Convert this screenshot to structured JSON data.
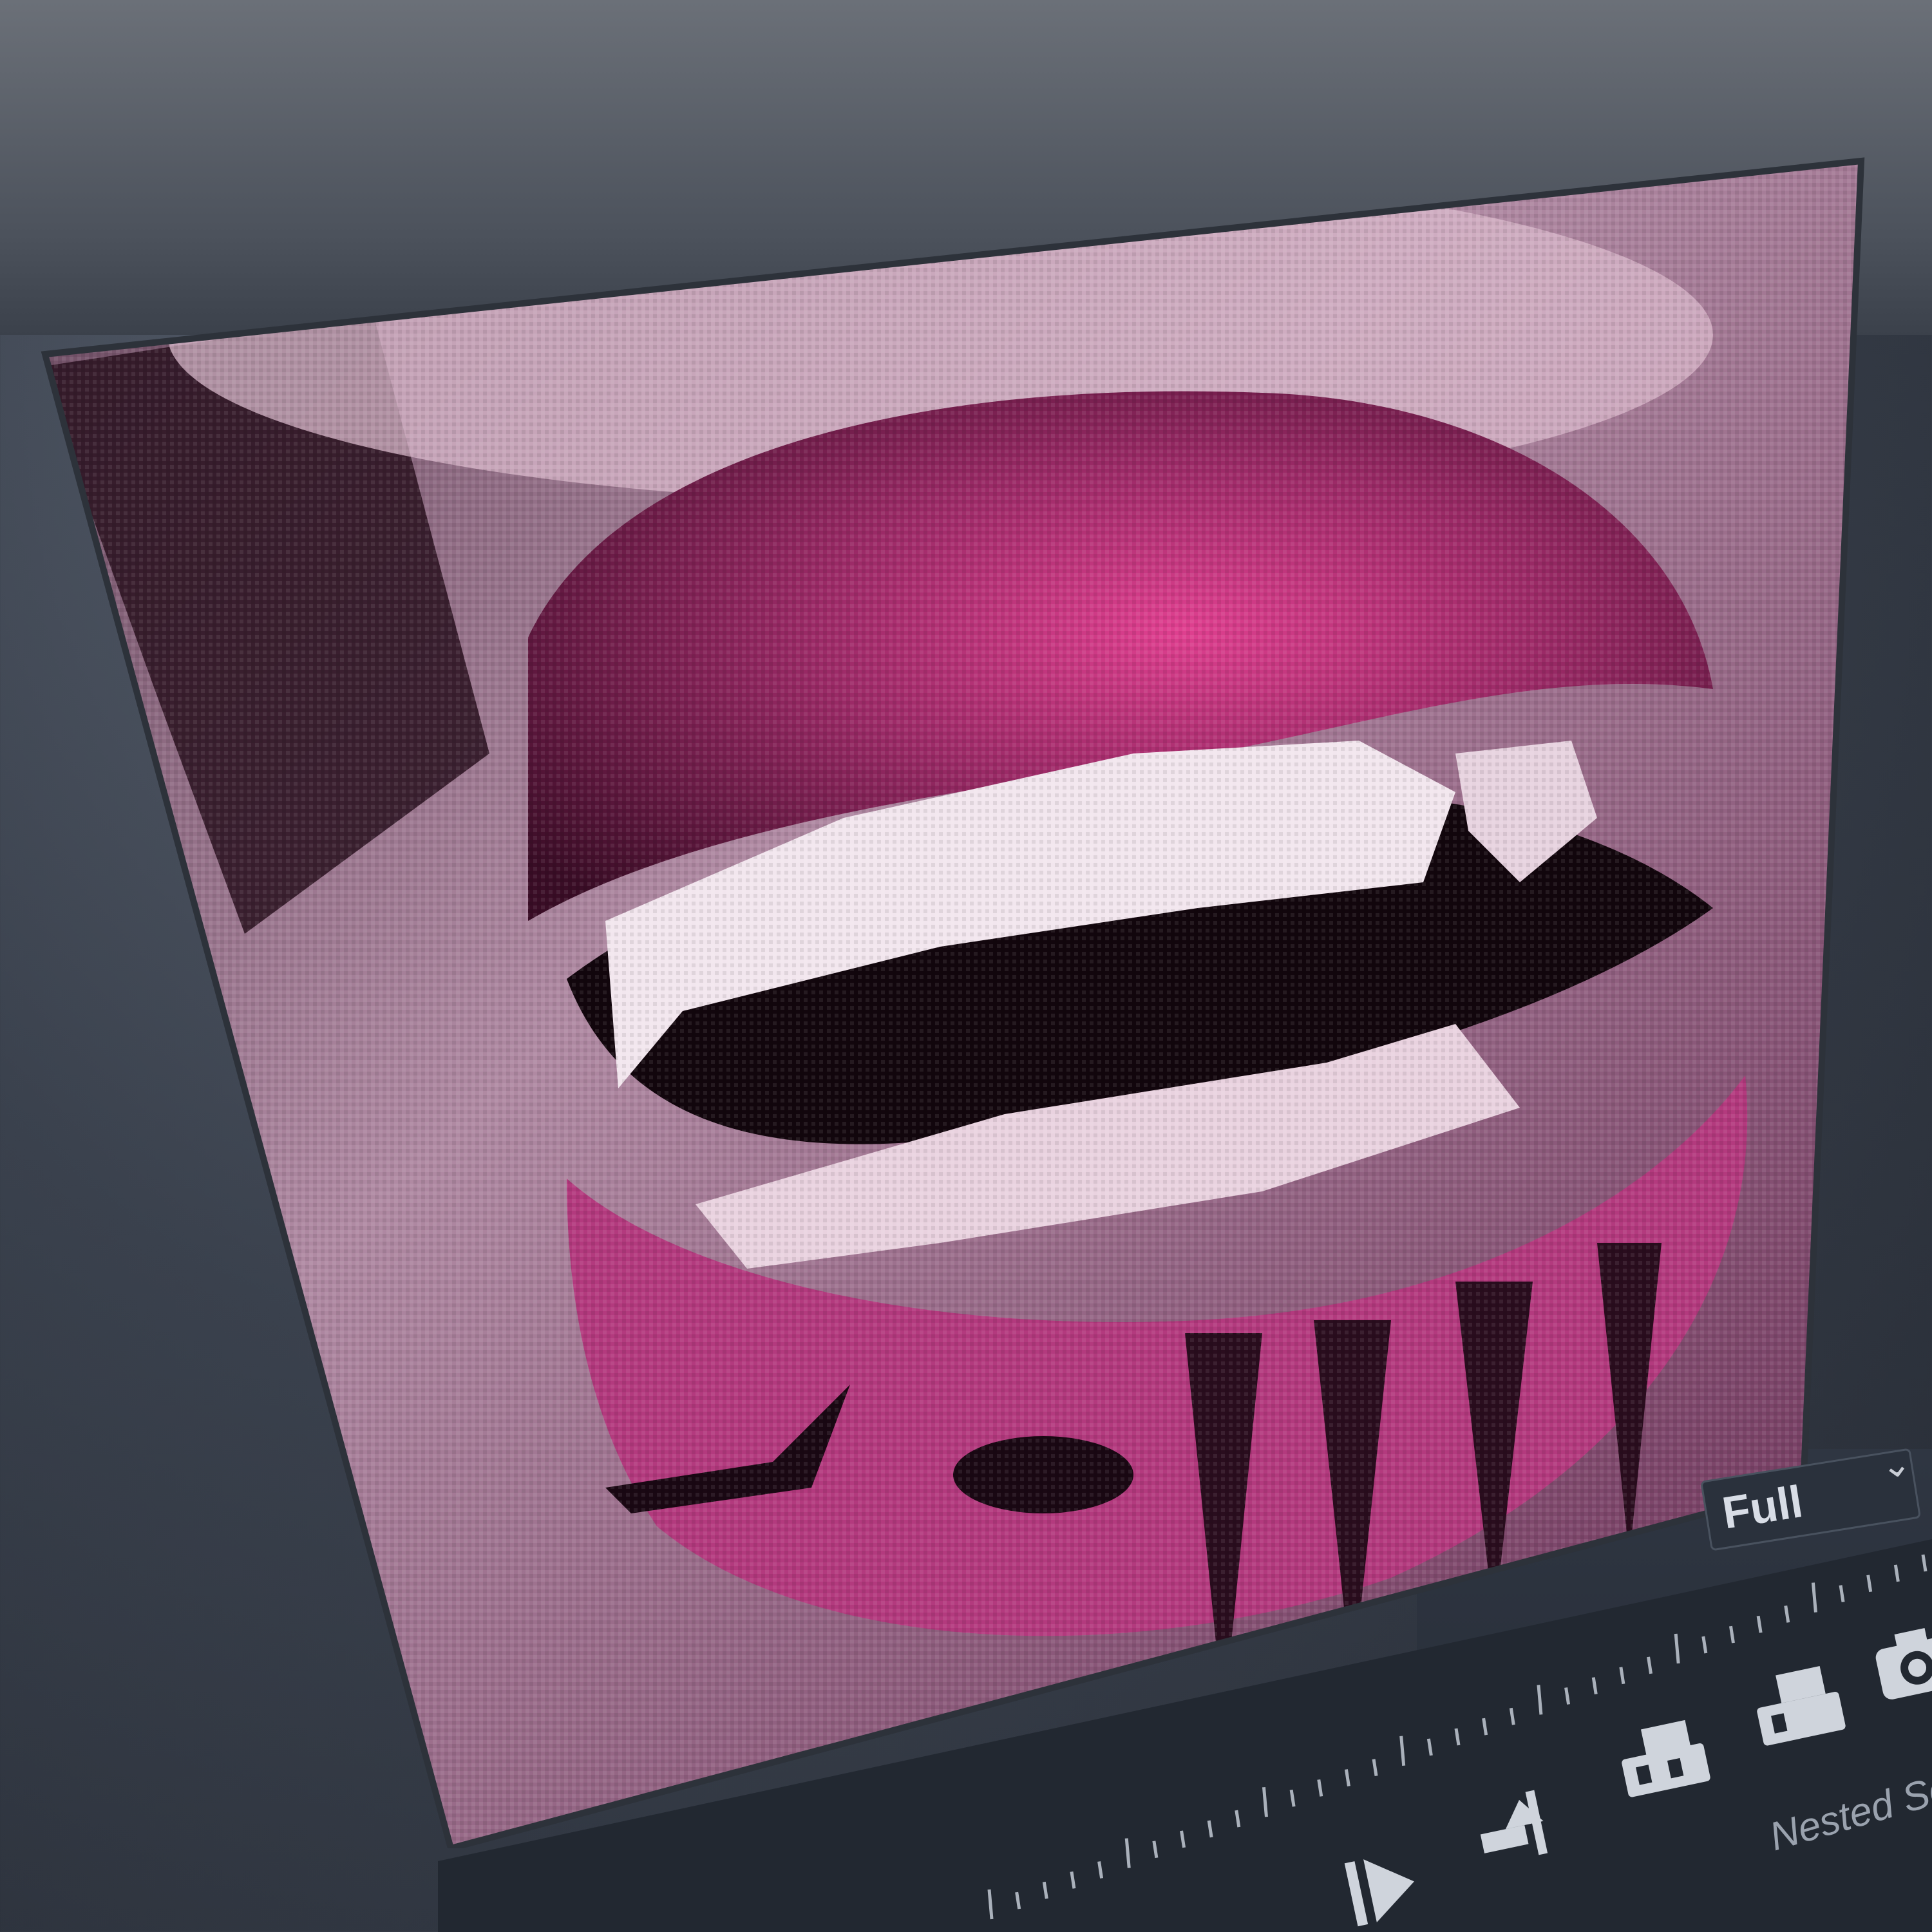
{
  "monitor": {
    "zoom_level": "Full",
    "chevron": "chevron-down-icon"
  },
  "timeline": {
    "nested_label": "Nested Se"
  },
  "controls": [
    {
      "name": "play-icon"
    },
    {
      "name": "lift-icon"
    },
    {
      "name": "insert-icon"
    },
    {
      "name": "overwrite-icon"
    },
    {
      "name": "camera-icon"
    }
  ],
  "colors": {
    "accent_pink": "#d03c8a",
    "ui_dark": "#252b35",
    "ui_text": "#d8dde6"
  }
}
